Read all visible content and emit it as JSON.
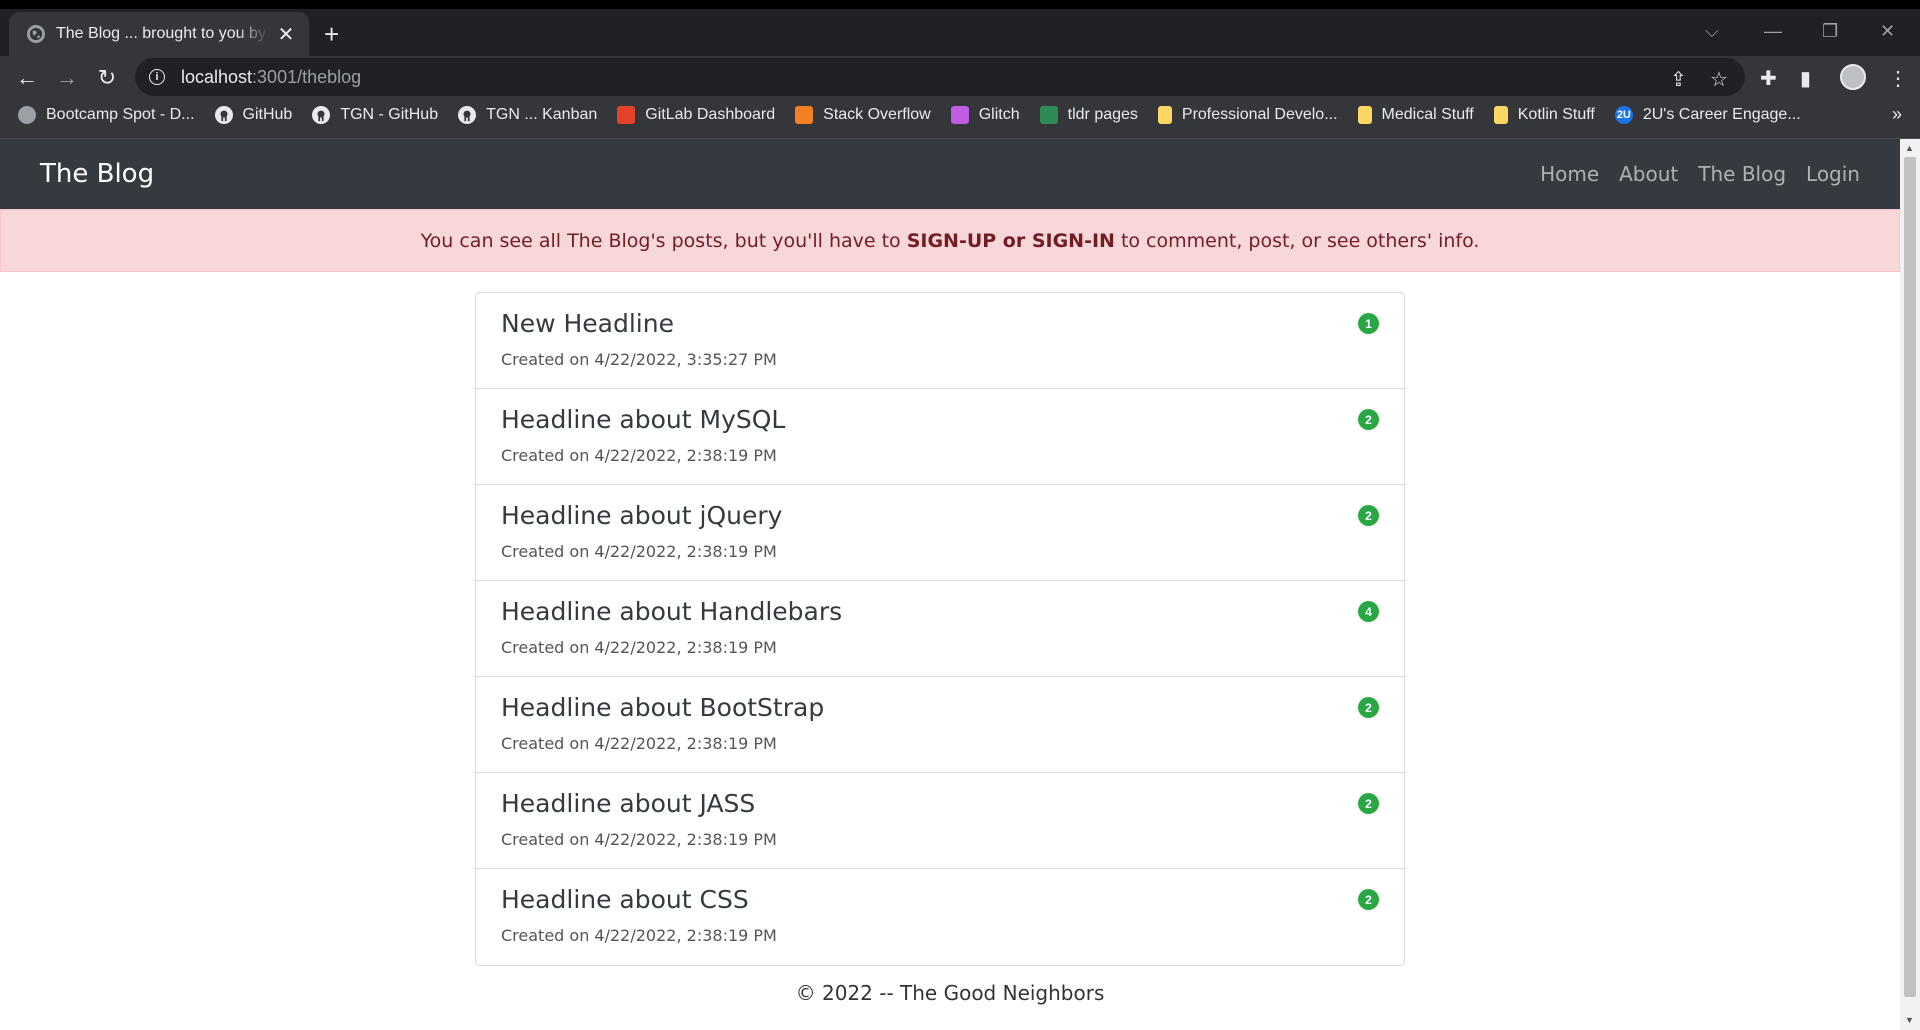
{
  "browser": {
    "tab_title": "The Blog ... brought to you by the Good Neighbors",
    "url_host": "localhost",
    "url_path": ":3001/theblog"
  },
  "bookmarks": [
    {
      "label": "Bootcamp Spot - D...",
      "icon": "globe-icon",
      "color": "#5f6368"
    },
    {
      "label": "GitHub",
      "icon": "github-icon",
      "color": "#e8eaed"
    },
    {
      "label": "TGN - GitHub",
      "icon": "github-icon",
      "color": "#e8eaed"
    },
    {
      "label": "TGN ... Kanban",
      "icon": "github-icon",
      "color": "#e8eaed"
    },
    {
      "label": "GitLab Dashboard",
      "icon": "gitlab-icon",
      "color": "#e24329"
    },
    {
      "label": "Stack Overflow",
      "icon": "stackoverflow-icon",
      "color": "#f48024"
    },
    {
      "label": "Glitch",
      "icon": "glitch-icon",
      "color": "#c05de2"
    },
    {
      "label": "tldr pages",
      "icon": "terminal-icon",
      "color": "#2e8b57"
    },
    {
      "label": "Professional Develo...",
      "icon": "folder-icon",
      "color": "#fdd663"
    },
    {
      "label": "Medical Stuff",
      "icon": "folder-icon",
      "color": "#fdd663"
    },
    {
      "label": "Kotlin Stuff",
      "icon": "folder-icon",
      "color": "#fdd663"
    },
    {
      "label": "2U's Career Engage...",
      "icon": "2u-icon",
      "color": "#1a73e8",
      "text": "2U"
    }
  ],
  "navbar": {
    "brand": "The Blog",
    "links": [
      "Home",
      "About",
      "The Blog",
      "Login"
    ]
  },
  "alert": {
    "before": "You can see all The Blog's posts, but you'll have to",
    "bold": "SIGN-UP or SIGN-IN",
    "after": "to comment, post, or see others' info."
  },
  "posts": [
    {
      "title": "New Headline",
      "created": "Created on 4/22/2022, 3:35:27 PM",
      "count": "1"
    },
    {
      "title": "Headline about MySQL",
      "created": "Created on 4/22/2022, 2:38:19 PM",
      "count": "2"
    },
    {
      "title": "Headline about jQuery",
      "created": "Created on 4/22/2022, 2:38:19 PM",
      "count": "2"
    },
    {
      "title": "Headline about Handlebars",
      "created": "Created on 4/22/2022, 2:38:19 PM",
      "count": "4"
    },
    {
      "title": "Headline about BootStrap",
      "created": "Created on 4/22/2022, 2:38:19 PM",
      "count": "2"
    },
    {
      "title": "Headline about JASS",
      "created": "Created on 4/22/2022, 2:38:19 PM",
      "count": "2"
    },
    {
      "title": "Headline about CSS",
      "created": "Created on 4/22/2022, 2:38:19 PM",
      "count": "2"
    }
  ],
  "footer": "© 2022 -- The Good Neighbors",
  "colors": {
    "badge": "#28a745",
    "navbar": "#343a40",
    "alert_bg": "#f8d7da"
  }
}
